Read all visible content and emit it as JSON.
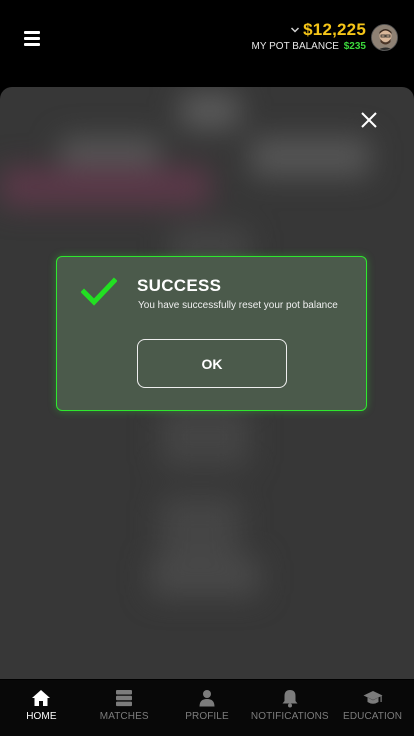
{
  "header": {
    "balance": "$12,225",
    "pot_label": "MY POT BALANCE",
    "pot_value": "$235",
    "icons": [
      "hamburger-menu-icon",
      "chevron-down-icon",
      "avatar"
    ]
  },
  "modal": {
    "title": "SUCCESS",
    "message": "You have successfully reset your pot balance",
    "ok_label": "OK",
    "accent_color": "#2ee82e",
    "icons": [
      "checkmark-icon",
      "close-icon"
    ]
  },
  "tabs": [
    {
      "label": "HOME",
      "icon": "home-icon",
      "active": true
    },
    {
      "label": "MATCHES",
      "icon": "matches-icon",
      "active": false
    },
    {
      "label": "PROFILE",
      "icon": "profile-icon",
      "active": false
    },
    {
      "label": "NOTIFICATIONS",
      "icon": "bell-icon",
      "active": false
    },
    {
      "label": "EDUCATION",
      "icon": "graduation-cap-icon",
      "active": false
    }
  ],
  "colors": {
    "balance": "#f5c518",
    "pot_value": "#3cd93c",
    "background": "#000000",
    "overlay": "#373737"
  }
}
